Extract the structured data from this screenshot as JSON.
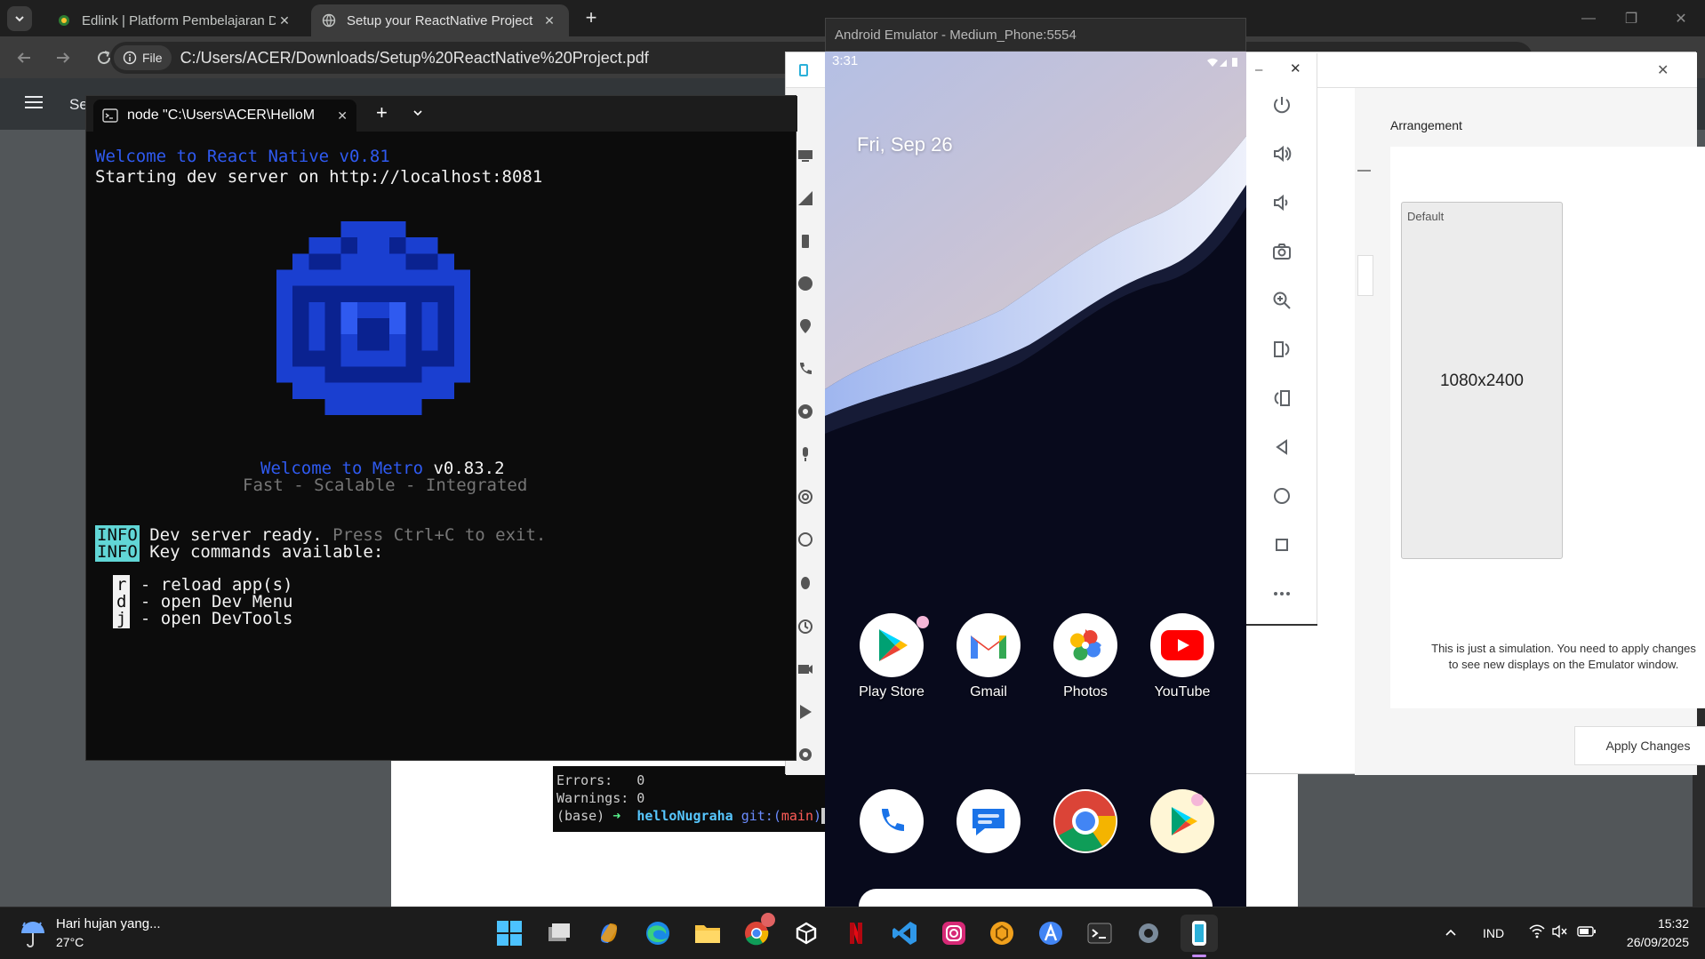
{
  "browser": {
    "tabs": [
      {
        "title": "Edlink | Platform Pembelajaran Daring",
        "active": false
      },
      {
        "title": "Setup your ReactNative Project",
        "active": true
      }
    ],
    "chip_label": "File",
    "url": "C:/Users/ACER/Downloads/Setup%20ReactNative%20Project.pdf",
    "pdf_title_fragment": "Se"
  },
  "mini_terminal": {
    "errors_line": "Errors:   0",
    "warnings_line": "Warnings: 0",
    "prompt_base": "(base) ",
    "prompt_arrow": "➜  ",
    "prompt_dir": "helloNugraha",
    "prompt_git": " git:(",
    "prompt_branch": "main",
    "prompt_close": ")"
  },
  "terminal": {
    "tab_title": "node  \"C:\\Users\\ACER\\HelloM",
    "line1": "Welcome to React Native v0.81",
    "line2": "Starting dev server on http://localhost:8081",
    "metro_welcome": "Welcome to Metro",
    "metro_version": " v0.83.2",
    "metro_tagline": "Fast - Scalable - Integrated",
    "info_tag": "INFO",
    "info1_text": " Dev server ready. ",
    "info1_hint": "Press Ctrl+C to exit.",
    "info2_text": " Key commands available:",
    "keys": [
      {
        "key": "r",
        "desc": " - reload app(s)"
      },
      {
        "key": "d",
        "desc": " - open Dev Menu"
      },
      {
        "key": "j",
        "desc": " - open DevTools"
      }
    ]
  },
  "emulator": {
    "window_title": "Android Emulator - Medium_Phone:5554",
    "status_time": "3:31",
    "date": "Fri, Sep 26",
    "apps_row1": [
      {
        "label": "Play Store",
        "icon": "play-store-icon"
      },
      {
        "label": "Gmail",
        "icon": "gmail-icon"
      },
      {
        "label": "Photos",
        "icon": "photos-icon"
      },
      {
        "label": "YouTube",
        "icon": "youtube-icon"
      }
    ],
    "apps_row2": [
      {
        "icon": "phone-app-icon"
      },
      {
        "icon": "messages-app-icon"
      },
      {
        "icon": "chrome-app-icon"
      },
      {
        "icon": "play-games-icon"
      }
    ]
  },
  "extended_controls": {
    "section": "Arrangement",
    "display_name": "Default",
    "resolution": "1080x2400",
    "note": "This is just a simulation. You need to apply changes to see new displays on the Emulator window.",
    "apply_label": "Apply Changes"
  },
  "taskbar": {
    "weather_text": "Hari hujan yang...",
    "temperature": "27°C",
    "language": "IND",
    "time": "15:32",
    "date": "26/09/2025"
  }
}
